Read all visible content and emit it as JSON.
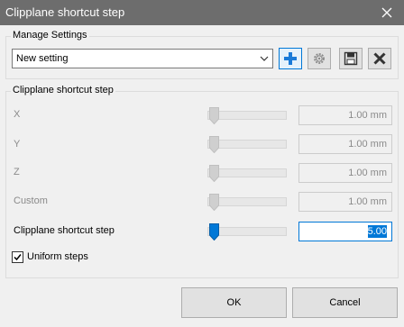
{
  "window": {
    "title": "Clipplane shortcut step"
  },
  "manage": {
    "group_label": "Manage Settings",
    "selected_setting": "New setting"
  },
  "step_group": {
    "label": "Clipplane shortcut step",
    "rows": [
      {
        "label": "X",
        "value": "1.00 mm"
      },
      {
        "label": "Y",
        "value": "1.00 mm"
      },
      {
        "label": "Z",
        "value": "1.00 mm"
      },
      {
        "label": "Custom",
        "value": "1.00 mm"
      }
    ],
    "main": {
      "label": "Clipplane shortcut step",
      "value": "5.00"
    },
    "uniform": {
      "label": "Uniform steps",
      "checked": true
    }
  },
  "buttons": {
    "ok": "OK",
    "cancel": "Cancel"
  },
  "colors": {
    "accent": "#0078d7",
    "titlebar": "#6d6d6d",
    "disabled_text": "#8a8a8a"
  }
}
